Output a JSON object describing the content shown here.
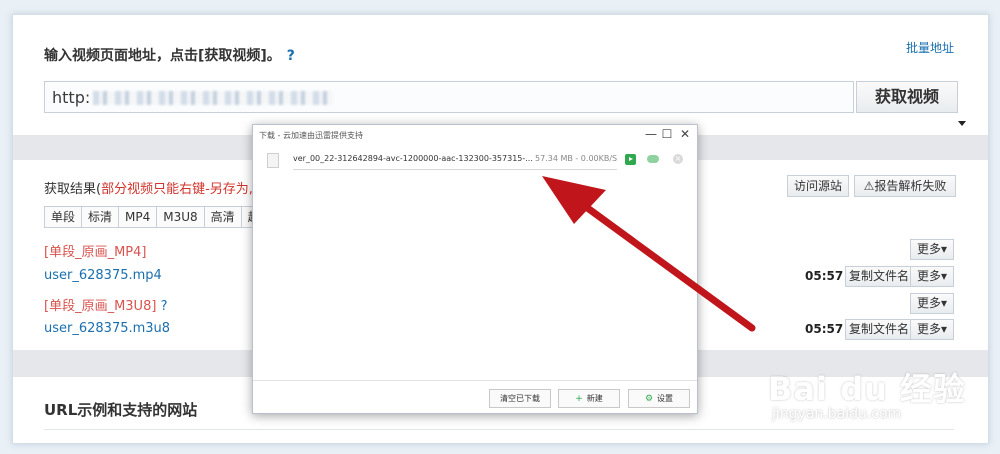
{
  "header": {
    "input_title": "输入视频页面地址，点击[获取视频]。",
    "help_mark": "?",
    "batch_link": "批量地址"
  },
  "url_input": {
    "value": "http:"
  },
  "fetch_button": "获取视频",
  "results": {
    "label_prefix": "获取结果(",
    "label_note": "部分视频只能右键-另存为,",
    "visit_source": "访问源站",
    "report_failure": "⚠报告解析失败",
    "tabs": [
      "单段",
      "标清",
      "MP4",
      "M3U8",
      "高清",
      "超清"
    ],
    "rows": [
      {
        "text": "[单段_原画_MP4]",
        "type": "group"
      },
      {
        "text": "user_628375.mp4",
        "type": "file",
        "duration": "05:57"
      },
      {
        "text": "[单段_原画_M3U8]",
        "type": "group",
        "suffix": "?"
      },
      {
        "text": "user_628375.m3u8",
        "type": "file",
        "duration": "05:57"
      }
    ],
    "more_label": "更多▾",
    "copy_filename": "复制文件名"
  },
  "examples": {
    "title": "URL示例和支持的网站"
  },
  "download_dialog": {
    "title": "下载 - 云加速由迅雷提供支持",
    "controls": {
      "minimize": "—",
      "maximize": "☐",
      "close": "✕"
    },
    "item": {
      "filename": "ver_00_22-312642894-avc-1200000-aac-132300-357315-...",
      "size_speed": "57.34 MB - 0.00KB/S",
      "icons": [
        "file-icon",
        "play-icon",
        "cloud-icon",
        "remove-icon"
      ]
    },
    "buttons": {
      "clear": "清空已下载",
      "new": "新建",
      "new_icon": "+",
      "settings": "设置",
      "settings_icon": "⚙"
    }
  },
  "watermark": {
    "brand": "Bai du 经验",
    "url": "jingyan.baidu.com"
  },
  "colors": {
    "link_blue": "#1a6faf",
    "note_red": "#d0342c",
    "arrow_red": "#c0161b",
    "accent_green": "#2fa84f"
  }
}
